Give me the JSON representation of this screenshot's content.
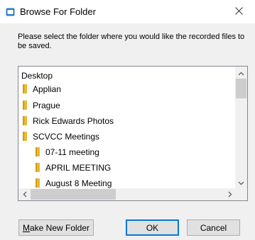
{
  "window": {
    "title": "Browse For Folder",
    "close_glyph": "close-icon"
  },
  "instruction": "Please select the folder where you would like the recorded files to be saved.",
  "tree": {
    "root": "Desktop",
    "items": [
      {
        "label": "Applian",
        "level": 1
      },
      {
        "label": "Prague",
        "level": 1
      },
      {
        "label": "Rick Edwards Photos",
        "level": 1
      },
      {
        "label": "SCVCC Meetings",
        "level": 1
      },
      {
        "label": "07-11 meeting",
        "level": 2
      },
      {
        "label": "APRIL MEETING",
        "level": 2
      },
      {
        "label": "August 8 Meeting",
        "level": 2
      }
    ],
    "folder_color": "#e8b931"
  },
  "buttons": {
    "make_new_folder_mnemonic": "M",
    "make_new_folder_rest": "ake New Folder",
    "ok": "OK",
    "cancel": "Cancel"
  },
  "colors": {
    "title_icon": "#2b79d0",
    "focus_border": "#0078d7"
  }
}
